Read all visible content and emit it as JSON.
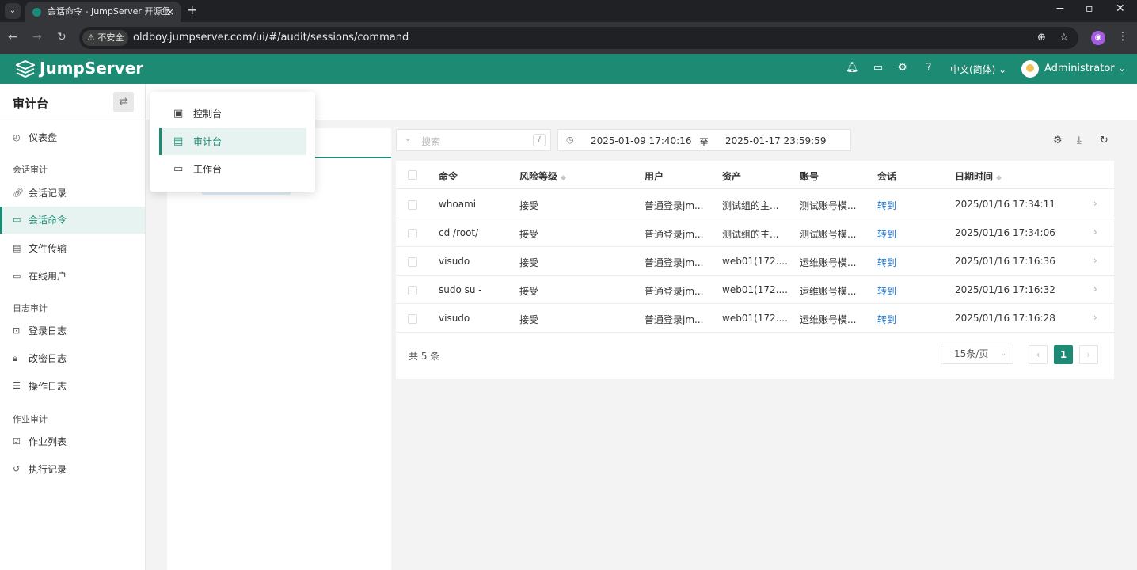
{
  "browser": {
    "tab_title": "会话命令 - JumpServer 开源堡",
    "tab_close": "×",
    "new_tab": "+",
    "security_chip": "⚠ 不安全",
    "url": "oldboy.jumpserver.com/ui/#/audit/sessions/command",
    "window_minimize": "−",
    "window_maximize": "▫",
    "window_close": "✕"
  },
  "header": {
    "logo_text": "JumpServer",
    "language": "中文(简体) ⌄",
    "user": "Administrator ⌄"
  },
  "sidebar": {
    "title": "审计台",
    "items": [
      {
        "label": "仪表盘",
        "icon": "dashboard-icon"
      },
      {
        "group": "会话审计"
      },
      {
        "label": "会话记录",
        "icon": "link-icon"
      },
      {
        "label": "会话命令",
        "icon": "terminal-icon",
        "active": true
      },
      {
        "label": "文件传输",
        "icon": "file-icon"
      },
      {
        "label": "在线用户",
        "icon": "monitor-user-icon"
      },
      {
        "group": "日志审计"
      },
      {
        "label": "登录日志",
        "icon": "login-icon"
      },
      {
        "label": "改密日志",
        "icon": "lock-icon"
      },
      {
        "label": "操作日志",
        "icon": "list-icon"
      },
      {
        "group": "作业审计"
      },
      {
        "label": "作业列表",
        "icon": "calendar-check-icon"
      },
      {
        "label": "执行记录",
        "icon": "history-icon"
      }
    ]
  },
  "workspace_menu": {
    "items": [
      {
        "label": "控制台",
        "icon": "console-icon"
      },
      {
        "label": "审计台",
        "icon": "audit-icon",
        "active": true
      },
      {
        "label": "工作台",
        "icon": "desktop-icon"
      }
    ]
  },
  "filters": {
    "search_placeholder": "搜索",
    "search_shortcut": "/",
    "date_start": "2025-01-09 17:40:16",
    "date_separator": "至",
    "date_end": "2025-01-17 23:59:59"
  },
  "table": {
    "columns": [
      "命令",
      "风险等级",
      "用户",
      "资产",
      "账号",
      "会话",
      "日期时间"
    ],
    "rows": [
      {
        "command": "whoami",
        "risk": "接受",
        "user": "普通登录jm...",
        "asset": "测试组的主...",
        "account": "测试账号模...",
        "session": "转到",
        "datetime": "2025/01/16 17:34:11"
      },
      {
        "command": "cd /root/",
        "risk": "接受",
        "user": "普通登录jm...",
        "asset": "测试组的主...",
        "account": "测试账号模...",
        "session": "转到",
        "datetime": "2025/01/16 17:34:06"
      },
      {
        "command": "visudo",
        "risk": "接受",
        "user": "普通登录jm...",
        "asset": "web01(172....",
        "account": "运维账号模...",
        "session": "转到",
        "datetime": "2025/01/16 17:16:36"
      },
      {
        "command": "sudo su -",
        "risk": "接受",
        "user": "普通登录jm...",
        "asset": "web01(172....",
        "account": "运维账号模...",
        "session": "转到",
        "datetime": "2025/01/16 17:16:32"
      },
      {
        "command": "visudo",
        "risk": "接受",
        "user": "普通登录jm...",
        "asset": "web01(172....",
        "account": "运维账号模...",
        "session": "转到",
        "datetime": "2025/01/16 17:16:28"
      }
    ]
  },
  "pagination": {
    "total": "共 5 条",
    "page_size": "15条/页",
    "current_page": "1"
  },
  "colors": {
    "brand": "#1d8a73",
    "link": "#1f7ad8"
  }
}
